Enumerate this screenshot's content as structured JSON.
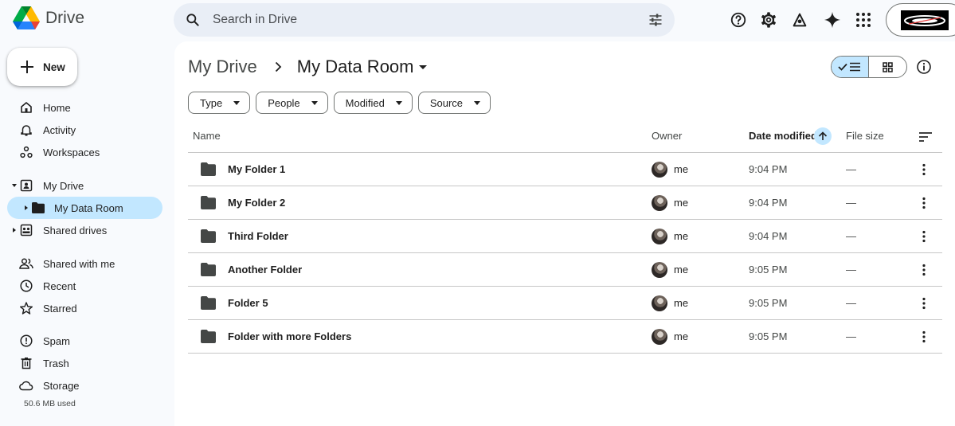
{
  "app": {
    "name": "Drive"
  },
  "search": {
    "placeholder": "Search in Drive"
  },
  "header_icons": [
    "help-icon",
    "settings-icon",
    "apps-script-icon",
    "gemini-icon",
    "google-apps-icon"
  ],
  "new_button": {
    "label": "New"
  },
  "sidebar": {
    "items": [
      {
        "label": "Home",
        "icon": "home-icon"
      },
      {
        "label": "Activity",
        "icon": "bell-icon"
      },
      {
        "label": "Workspaces",
        "icon": "workspaces-icon"
      },
      {
        "label": "My Drive",
        "icon": "my-drive-icon"
      },
      {
        "label": "My Data Room",
        "icon": "folder-icon"
      },
      {
        "label": "Shared drives",
        "icon": "shared-drives-icon"
      },
      {
        "label": "Shared with me",
        "icon": "people-icon"
      },
      {
        "label": "Recent",
        "icon": "clock-icon"
      },
      {
        "label": "Starred",
        "icon": "star-icon"
      },
      {
        "label": "Spam",
        "icon": "spam-icon"
      },
      {
        "label": "Trash",
        "icon": "trash-icon"
      },
      {
        "label": "Storage",
        "icon": "cloud-icon"
      }
    ],
    "storage_used": "50.6 MB used"
  },
  "breadcrumb": {
    "parent": "My Drive",
    "current": "My Data Room"
  },
  "filters": [
    "Type",
    "People",
    "Modified",
    "Source"
  ],
  "table": {
    "columns": {
      "name": "Name",
      "owner": "Owner",
      "date": "Date modified",
      "size": "File size"
    },
    "rows": [
      {
        "name": "My Folder 1",
        "owner": "me",
        "date": "9:04 PM",
        "size": "—"
      },
      {
        "name": "My Folder 2",
        "owner": "me",
        "date": "9:04 PM",
        "size": "—"
      },
      {
        "name": "Third Folder",
        "owner": "me",
        "date": "9:04 PM",
        "size": "—"
      },
      {
        "name": "Another Folder",
        "owner": "me",
        "date": "9:05 PM",
        "size": "—"
      },
      {
        "name": "Folder 5",
        "owner": "me",
        "date": "9:05 PM",
        "size": "—"
      },
      {
        "name": "Folder with more Folders",
        "owner": "me",
        "date": "9:05 PM",
        "size": "—"
      }
    ]
  },
  "colors": {
    "accent": "#c2e7ff",
    "search_bg": "#e9eef6",
    "page_bg": "#f8fafd",
    "text": "#1f1f1f"
  }
}
